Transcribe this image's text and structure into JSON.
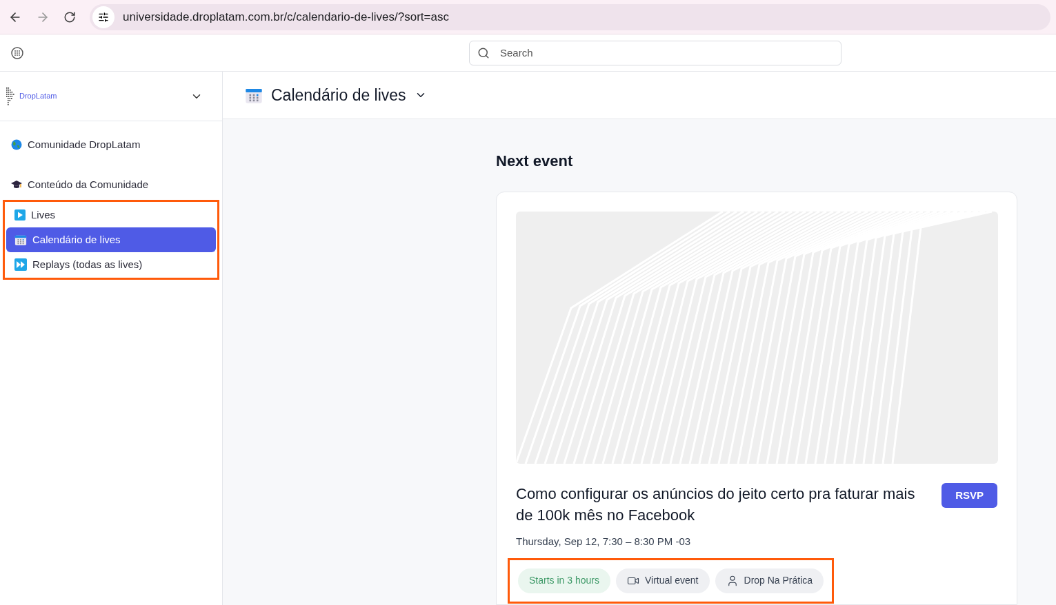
{
  "browser": {
    "url": "universidade.droplatam.com.br/c/calendario-de-lives/?sort=asc"
  },
  "search": {
    "placeholder": "Search"
  },
  "sidebar": {
    "brand": "DropLatam",
    "items": [
      {
        "label": "Comunidade DropLatam",
        "kind": "globe",
        "selected": false,
        "highlighted": false
      },
      {
        "label": "Conteúdo da Comunidade",
        "kind": "cap",
        "selected": false,
        "highlighted": false
      },
      {
        "label": "Lives",
        "kind": "play",
        "selected": false,
        "highlighted": true
      },
      {
        "label": "Calendário de lives",
        "kind": "calendar",
        "selected": true,
        "highlighted": true
      },
      {
        "label": "Replays (todas as lives)",
        "kind": "forward",
        "selected": false,
        "highlighted": true
      }
    ]
  },
  "header": {
    "title": "Calendário de lives"
  },
  "section_title": "Next event",
  "event": {
    "title": "Como configurar os anúncios do jeito certo pra faturar mais de 100k mês no Facebook",
    "rsvp": "RSVP",
    "date": "Thursday, Sep 12, 7:30 – 8:30 PM -03",
    "tags_highlighted": true,
    "tags": [
      {
        "label": "Starts in 3 hours",
        "kind": "status"
      },
      {
        "label": "Virtual event",
        "kind": "video"
      },
      {
        "label": "Drop Na Prática",
        "kind": "host"
      }
    ]
  }
}
